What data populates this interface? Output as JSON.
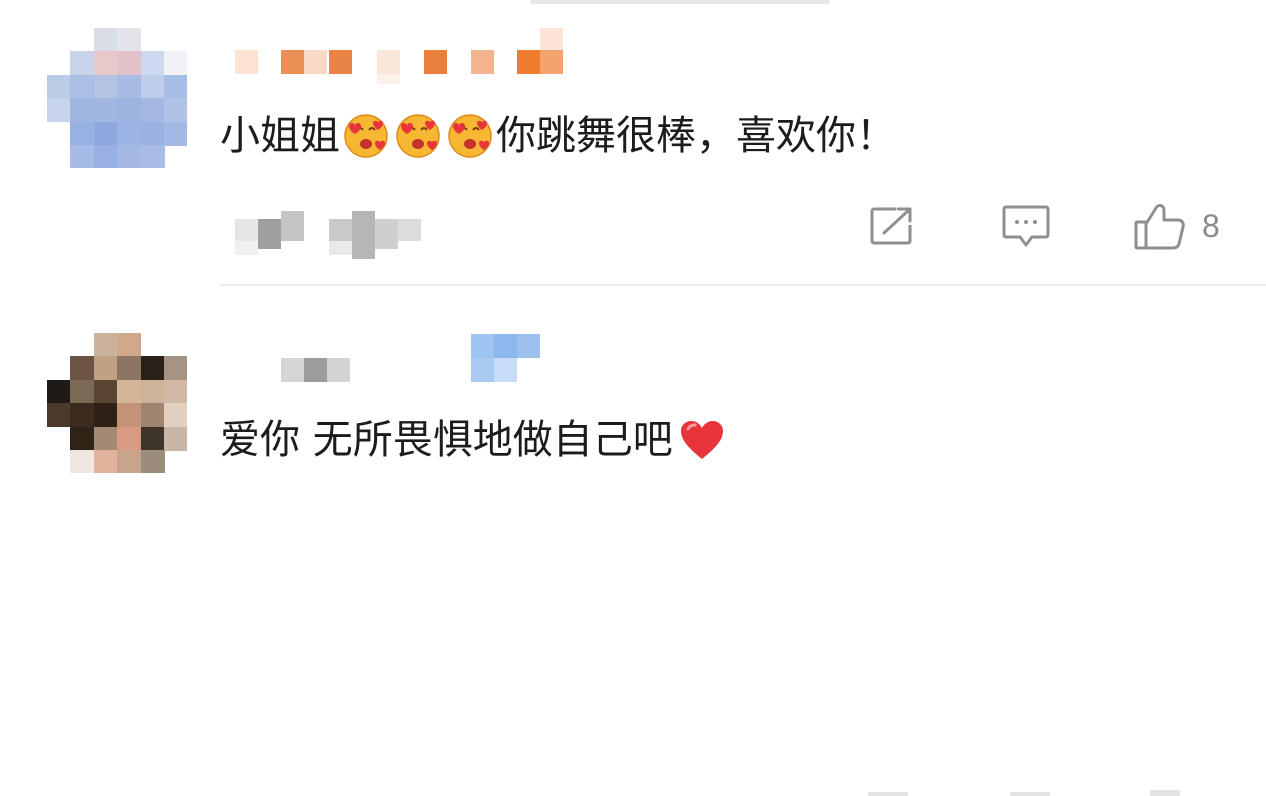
{
  "comments": [
    {
      "text_before_emoji": "小姐姐",
      "emojis": [
        "face-with-hearts-emoji",
        "face-with-hearts-emoji",
        "face-with-hearts-emoji"
      ],
      "text_after_emoji": "你跳舞很棒，喜欢你！",
      "actions": {
        "share_icon": "share-icon",
        "comment_icon": "comment-icon",
        "like_icon": "thumbs-up-icon",
        "like_count": "8"
      }
    },
    {
      "text": "爱你 无所畏惧地做自己吧",
      "trailing_emoji": "red-heart-emoji"
    }
  ],
  "colors": {
    "text": "#1c1c1c",
    "icon": "#8f8f8f",
    "divider": "#ececec",
    "heart": "#e8343a"
  }
}
